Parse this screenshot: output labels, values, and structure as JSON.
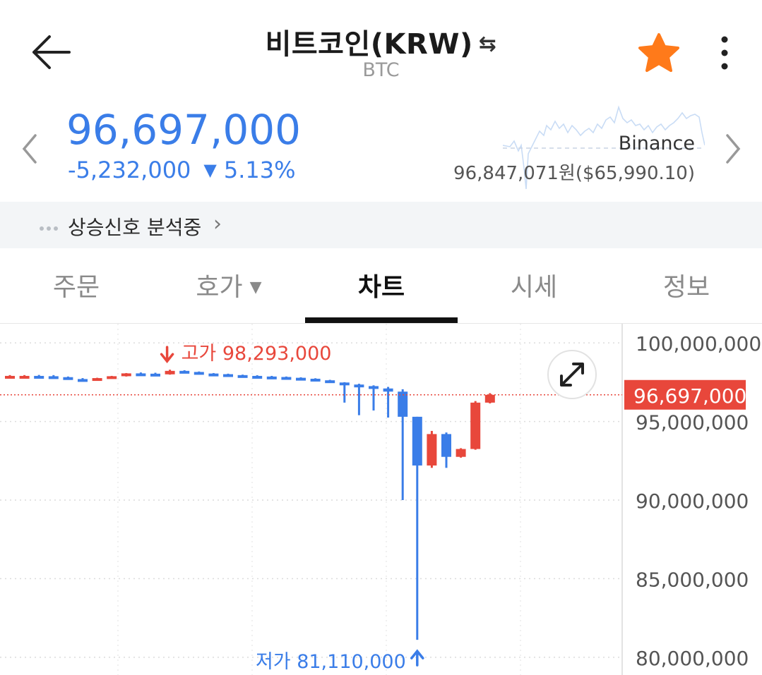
{
  "header": {
    "title": "비트코인(KRW)",
    "swap_icon": "⇆",
    "subtitle": "BTC",
    "icons": [
      "back-arrow-icon",
      "swap-icon",
      "star-icon",
      "more-vertical-icon"
    ],
    "star_color": "#ff7a1a"
  },
  "price": {
    "current": "96,697,000",
    "change_amount": "-5,232,000",
    "change_percent": "5.13%",
    "direction_icon": "▼",
    "color": "#3a7de8"
  },
  "exchange": {
    "name": "Binance",
    "price": "96,847,071원($65,990.10)"
  },
  "signal": {
    "label": "상승신호 분석중",
    "chevron": "›"
  },
  "tabs": [
    {
      "label": "주문",
      "active": false
    },
    {
      "label": "호가",
      "active": false,
      "has_dropdown": true
    },
    {
      "label": "차트",
      "active": true
    },
    {
      "label": "시세",
      "active": false
    },
    {
      "label": "정보",
      "active": false
    }
  ],
  "tab_dropdown_icon": "▼",
  "chart_data": {
    "type": "candlestick",
    "y_ticks": [
      "100,000,000",
      "95,000,000",
      "90,000,000",
      "85,000,000",
      "80,000,000"
    ],
    "y_tick_values": [
      100000000,
      95000000,
      90000000,
      85000000,
      80000000
    ],
    "ylim": [
      79500000,
      100500000
    ],
    "current_price_label": "96,697,000",
    "current_price": 96697000,
    "high_label": "고가 98,293,000",
    "high_value": 98293000,
    "low_label": "저가 81,110,000",
    "low_value": 81110000,
    "colors": {
      "up": "#e8473b",
      "down": "#3a7de8",
      "current": "#e8473b"
    },
    "candles": [
      {
        "o": 97900000,
        "h": 97950000,
        "l": 97850000,
        "c": 97900000
      },
      {
        "o": 97880000,
        "h": 97950000,
        "l": 97820000,
        "c": 97900000
      },
      {
        "o": 97900000,
        "h": 97960000,
        "l": 97840000,
        "c": 97880000
      },
      {
        "o": 97880000,
        "h": 97950000,
        "l": 97800000,
        "c": 97820000
      },
      {
        "o": 97820000,
        "h": 97860000,
        "l": 97680000,
        "c": 97700000
      },
      {
        "o": 97700000,
        "h": 97760000,
        "l": 97620000,
        "c": 97640000
      },
      {
        "o": 97640000,
        "h": 97780000,
        "l": 97600000,
        "c": 97760000
      },
      {
        "o": 97760000,
        "h": 97900000,
        "l": 97740000,
        "c": 97880000
      },
      {
        "o": 97880000,
        "h": 98080000,
        "l": 97860000,
        "c": 98060000
      },
      {
        "o": 98060000,
        "h": 98120000,
        "l": 98020000,
        "c": 98040000
      },
      {
        "o": 98040000,
        "h": 98100000,
        "l": 97960000,
        "c": 98000000
      },
      {
        "o": 98000000,
        "h": 98293000,
        "l": 97980000,
        "c": 98220000
      },
      {
        "o": 98220000,
        "h": 98260000,
        "l": 98120000,
        "c": 98150000
      },
      {
        "o": 98150000,
        "h": 98180000,
        "l": 98020000,
        "c": 98050000
      },
      {
        "o": 98050000,
        "h": 98080000,
        "l": 97980000,
        "c": 98010000
      },
      {
        "o": 98010000,
        "h": 98040000,
        "l": 97920000,
        "c": 97950000
      },
      {
        "o": 97950000,
        "h": 97980000,
        "l": 97880000,
        "c": 97900000
      },
      {
        "o": 97900000,
        "h": 97940000,
        "l": 97840000,
        "c": 97860000
      },
      {
        "o": 97860000,
        "h": 97900000,
        "l": 97800000,
        "c": 97830000
      },
      {
        "o": 97830000,
        "h": 97860000,
        "l": 97760000,
        "c": 97780000
      },
      {
        "o": 97780000,
        "h": 97810000,
        "l": 97700000,
        "c": 97720000
      },
      {
        "o": 97720000,
        "h": 97750000,
        "l": 97600000,
        "c": 97620000
      },
      {
        "o": 97620000,
        "h": 97650000,
        "l": 97450000,
        "c": 97480000
      },
      {
        "o": 97480000,
        "h": 97500000,
        "l": 96200000,
        "c": 97350000
      },
      {
        "o": 97350000,
        "h": 97400000,
        "l": 95400000,
        "c": 97250000
      },
      {
        "o": 97250000,
        "h": 97300000,
        "l": 95700000,
        "c": 97100000
      },
      {
        "o": 97100000,
        "h": 97200000,
        "l": 95250000,
        "c": 96900000
      },
      {
        "o": 96900000,
        "h": 97050000,
        "l": 90000000,
        "c": 95300000
      },
      {
        "o": 95300000,
        "h": 95300000,
        "l": 81110000,
        "c": 92200000
      },
      {
        "o": 92200000,
        "h": 94400000,
        "l": 92050000,
        "c": 94200000
      },
      {
        "o": 94200000,
        "h": 94300000,
        "l": 92050000,
        "c": 92750000
      },
      {
        "o": 92750000,
        "h": 93300000,
        "l": 92700000,
        "c": 93250000
      },
      {
        "o": 93250000,
        "h": 96300000,
        "l": 93200000,
        "c": 96200000
      },
      {
        "o": 96200000,
        "h": 96800000,
        "l": 96150000,
        "c": 96697000
      }
    ]
  }
}
